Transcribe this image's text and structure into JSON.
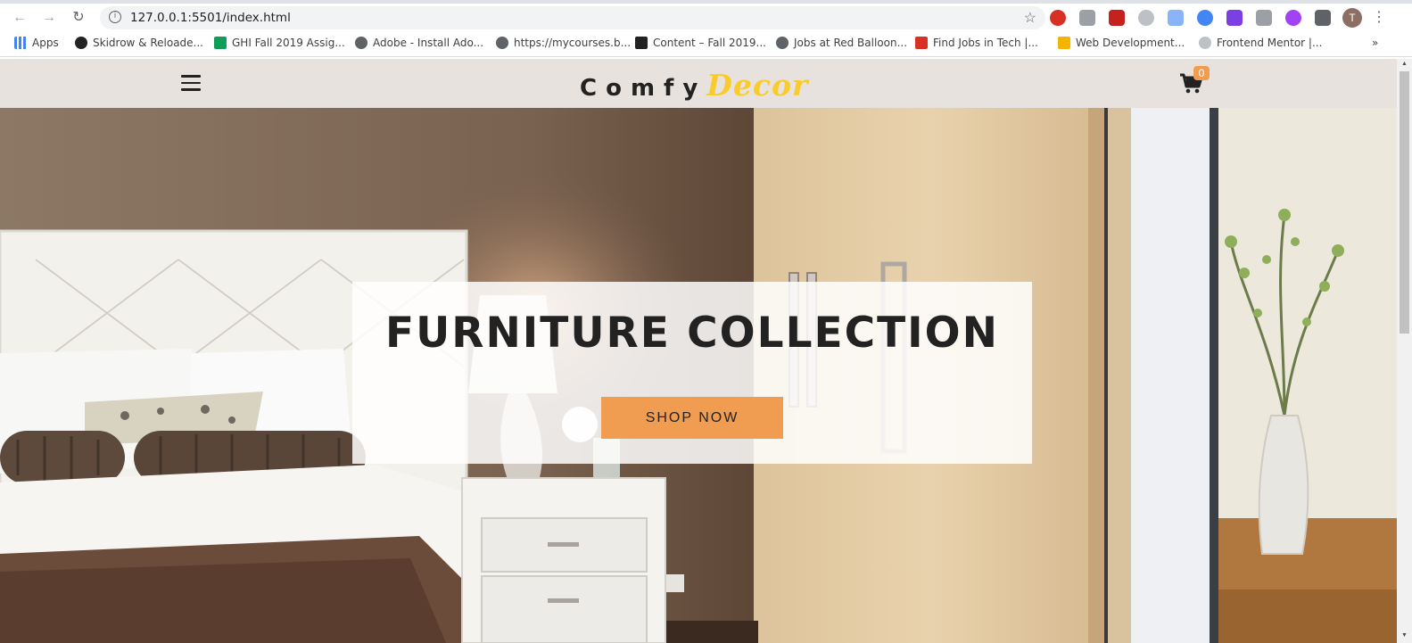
{
  "browser": {
    "url": "127.0.0.1:5501/index.html",
    "bookmarks": [
      {
        "label": "Apps",
        "color": "#4285f4"
      },
      {
        "label": "Skidrow & Reloade...",
        "color": "#222222"
      },
      {
        "label": "GHI Fall 2019 Assig...",
        "color": "#0f9d58"
      },
      {
        "label": "Adobe - Install Ado...",
        "color": "#5f6368"
      },
      {
        "label": "https://mycourses.b...",
        "color": "#5f6368"
      },
      {
        "label": "Content – Fall 2019...",
        "color": "#222222"
      },
      {
        "label": "Jobs at Red Balloon...",
        "color": "#5f6368"
      },
      {
        "label": "Find Jobs in Tech |...",
        "color": "#d93025"
      },
      {
        "label": "Web Development...",
        "color": "#f4b400"
      },
      {
        "label": "Frontend Mentor |...",
        "color": "#5f6368"
      }
    ],
    "more_bookmarks": "»",
    "profile_initial": "T"
  },
  "site": {
    "logo_part1": "Comfy",
    "logo_part2": "Decor",
    "cart_count": "0",
    "hero_title": "FURNITURE COLLECTION",
    "hero_button": "SHOP NOW",
    "colors": {
      "navbar": "#e7e2dd",
      "accent": "#f09d51",
      "logo_accent": "#f9cc2b"
    }
  }
}
